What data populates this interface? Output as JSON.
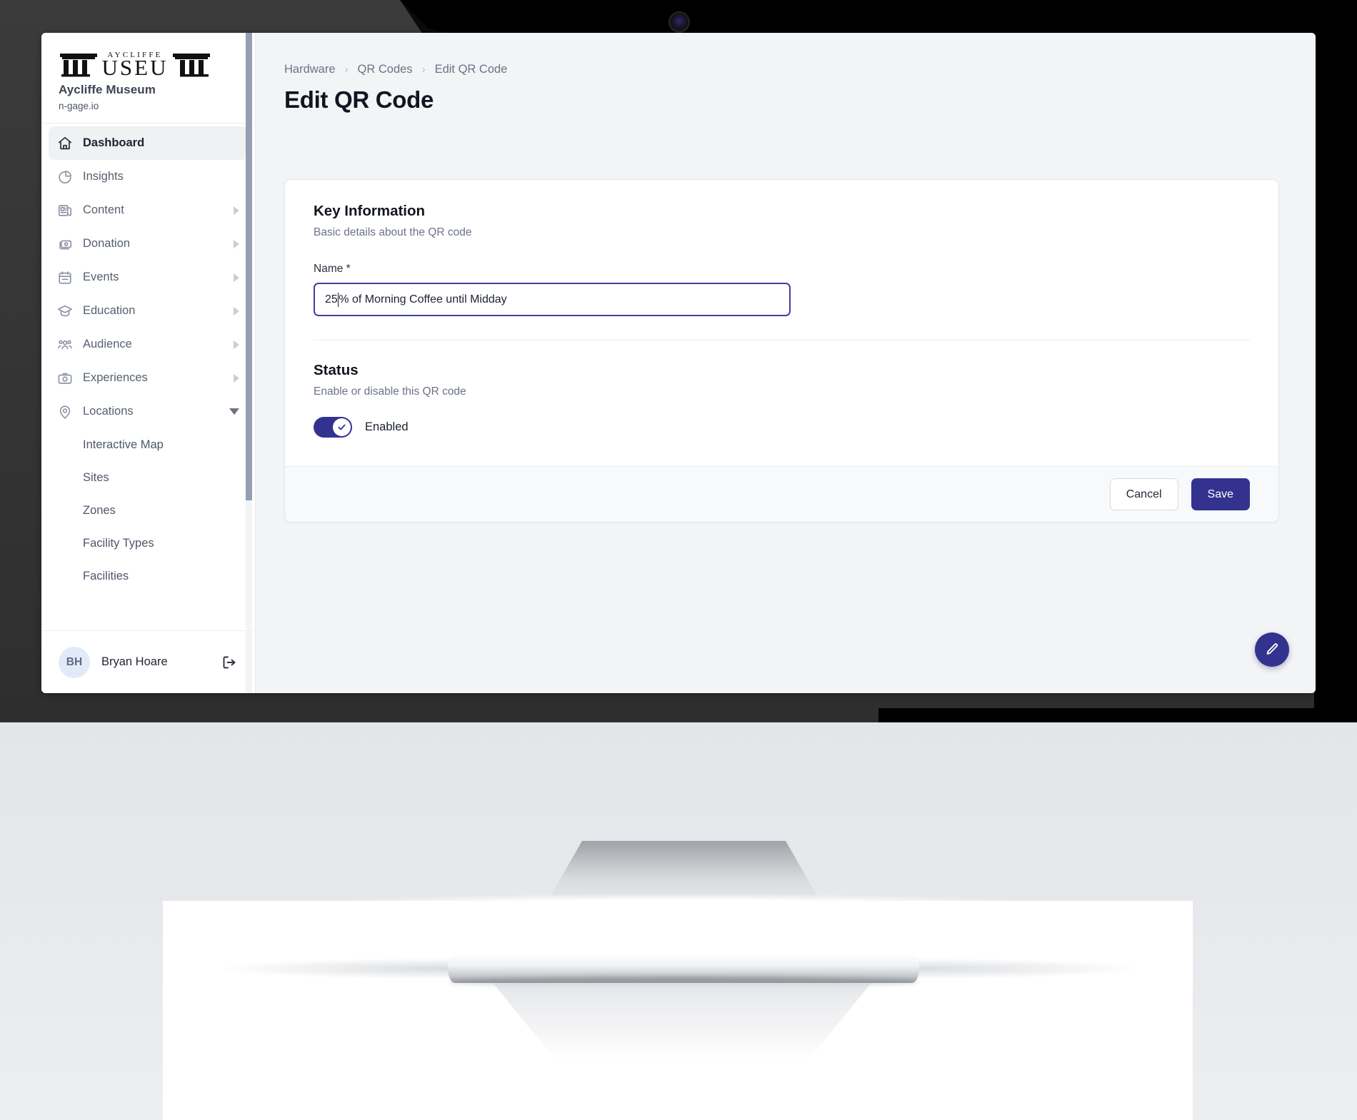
{
  "brand": {
    "logo_top_text": "AYCLIFFE",
    "logo_main_text": "MUSEUM",
    "name": "Aycliffe Museum",
    "domain": "n-gage.io"
  },
  "sidebar": {
    "items": [
      {
        "label": "Dashboard",
        "icon": "home-icon",
        "active": true,
        "expandable": false
      },
      {
        "label": "Insights",
        "icon": "pie-chart-icon",
        "active": false,
        "expandable": false
      },
      {
        "label": "Content",
        "icon": "newspaper-icon",
        "active": false,
        "expandable": true
      },
      {
        "label": "Donation",
        "icon": "money-icon",
        "active": false,
        "expandable": true
      },
      {
        "label": "Events",
        "icon": "calendar-icon",
        "active": false,
        "expandable": true
      },
      {
        "label": "Education",
        "icon": "graduation-icon",
        "active": false,
        "expandable": true
      },
      {
        "label": "Audience",
        "icon": "people-icon",
        "active": false,
        "expandable": true
      },
      {
        "label": "Experiences",
        "icon": "camera-icon",
        "active": false,
        "expandable": true
      },
      {
        "label": "Locations",
        "icon": "map-pin-icon",
        "active": false,
        "expandable": true,
        "expanded": true
      }
    ],
    "sub_items": [
      {
        "label": "Interactive Map"
      },
      {
        "label": "Sites"
      },
      {
        "label": "Zones"
      },
      {
        "label": "Facility Types"
      },
      {
        "label": "Facilities"
      }
    ],
    "user": {
      "initials": "BH",
      "name": "Bryan Hoare",
      "logout_icon": "logout-icon"
    }
  },
  "breadcrumb": [
    {
      "label": "Hardware"
    },
    {
      "label": "QR Codes"
    },
    {
      "label": "Edit QR Code"
    }
  ],
  "breadcrumb_separator": "›",
  "page": {
    "title": "Edit QR Code"
  },
  "form": {
    "key_information": {
      "title": "Key Information",
      "description": "Basic details about the QR code",
      "name_label": "Name *",
      "name_value_before_caret": "25",
      "name_value_after_caret": "% of Morning Coffee until Midday",
      "name_value": "25% of Morning Coffee until Midday",
      "name_placeholder": "Name"
    },
    "status": {
      "title": "Status",
      "description": "Enable or disable this QR code",
      "toggle_label": "Enabled",
      "toggle_on": true,
      "toggle_icon": "check-icon"
    },
    "actions": {
      "cancel_label": "Cancel",
      "save_label": "Save"
    }
  },
  "fab": {
    "icon": "pencil-icon"
  },
  "colors": {
    "accent": "#33338f",
    "page_bg": "#f3f4f6",
    "card_bg": "#ffffff",
    "footer_bg": "#f7f9fb",
    "text_primary": "#11151f",
    "text_muted": "#6b7385",
    "bezel": "#343434",
    "avatar_bg": "#e3eaf7"
  }
}
